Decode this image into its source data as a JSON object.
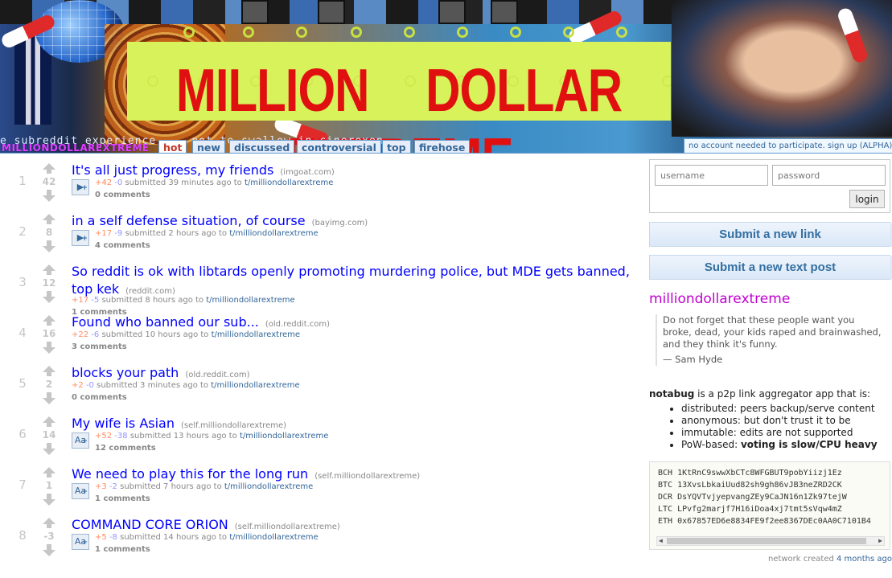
{
  "header": {
    "banner_title": "MILLION DOLLAR EXTREME",
    "ticker": "e subreddit experience ... not to swallow in cinerexen",
    "subreddit_name": "MILLIONDOLLAREXTREME",
    "tabs": [
      {
        "label": "hot",
        "selected": true
      },
      {
        "label": "new",
        "selected": false
      },
      {
        "label": "discussed",
        "selected": false
      },
      {
        "label": "controversial",
        "selected": false
      },
      {
        "label": "top",
        "selected": false
      },
      {
        "label": "firehose",
        "selected": false
      }
    ],
    "signup_text": "no account needed to participate. sign up (ALPHA)"
  },
  "posts": [
    {
      "rank": "1",
      "score": "42",
      "title": "It's all just progress, my friends",
      "domain": "(imgoat.com)",
      "type": "video",
      "ups": "+42",
      "downs": "-0",
      "time": "submitted 39 minutes ago to",
      "sub": "t/milliondollarextreme",
      "comments": "0 comments"
    },
    {
      "rank": "2",
      "score": "8",
      "title": "in a self defense situation, of course",
      "domain": "(bayimg.com)",
      "type": "video",
      "ups": "+17",
      "downs": "-9",
      "time": "submitted 2 hours ago to",
      "sub": "t/milliondollarextreme",
      "comments": "4 comments"
    },
    {
      "rank": "3",
      "score": "12",
      "title": "So reddit is ok with libtards openly promoting murdering police, but MDE gets banned, top kek",
      "domain": "(reddit.com)",
      "type": "none",
      "ups": "+17",
      "downs": "-5",
      "time": "submitted 8 hours ago to",
      "sub": "t/milliondollarextreme",
      "comments": "1 comments"
    },
    {
      "rank": "4",
      "score": "16",
      "title": "Found who banned our sub...",
      "domain": "(old.reddit.com)",
      "type": "none",
      "ups": "+22",
      "downs": "-6",
      "time": "submitted 10 hours ago to",
      "sub": "t/milliondollarextreme",
      "comments": "3 comments"
    },
    {
      "rank": "5",
      "score": "2",
      "title": "blocks your path",
      "domain": "(old.reddit.com)",
      "type": "none",
      "ups": "+2",
      "downs": "-0",
      "time": "submitted 3 minutes ago to",
      "sub": "t/milliondollarextreme",
      "comments": "0 comments"
    },
    {
      "rank": "6",
      "score": "14",
      "title": "My wife is Asian",
      "domain": "(self.milliondollarextreme)",
      "type": "text",
      "ups": "+52",
      "downs": "-38",
      "time": "submitted 13 hours ago to",
      "sub": "t/milliondollarextreme",
      "comments": "12 comments"
    },
    {
      "rank": "7",
      "score": "1",
      "title": "We need to play this for the long run",
      "domain": "(self.milliondollarextreme)",
      "type": "text",
      "ups": "+3",
      "downs": "-2",
      "time": "submitted 7 hours ago to",
      "sub": "t/milliondollarextreme",
      "comments": "1 comments"
    },
    {
      "rank": "8",
      "score": "-3",
      "title": "COMMAND CORE ORION",
      "domain": "(self.milliondollarextreme)",
      "type": "text",
      "ups": "+5",
      "downs": "-8",
      "time": "submitted 14 hours ago to",
      "sub": "t/milliondollarextreme",
      "comments": "1 comments"
    }
  ],
  "sidebar": {
    "username_placeholder": "username",
    "password_placeholder": "password",
    "login_label": "login",
    "submit_link_label": "Submit a new link",
    "submit_text_label": "Submit a new text post",
    "subreddit_title": "milliondollarextreme",
    "quote_text": "Do not forget that these people want you broke, dead, your kids raped and brainwashed, and they think it's funny.",
    "quote_attrib": "— Sam Hyde",
    "about_brand": "notabug",
    "about_intro": " is a p2p link aggregator app that is:",
    "about_items": [
      {
        "text": "distributed: peers backup/serve content",
        "bold": ""
      },
      {
        "text": "anonymous: but don't trust it to be",
        "bold": ""
      },
      {
        "text": "immutable: edits are not supported",
        "bold": ""
      },
      {
        "text": "PoW-based: ",
        "bold": "voting is slow/CPU heavy"
      }
    ],
    "wallets": [
      {
        "coin": "BCH",
        "addr": "1KtRnC9swwXbCTc8WFGBUT9pobYiizj1Ez"
      },
      {
        "coin": "BTC",
        "addr": "13XvsLbkaiUud82sh9gh86vJB3neZRD2CK"
      },
      {
        "coin": "DCR",
        "addr": "DsYQVTvjyepvangZEy9CaJN16n1Zk97tejW"
      },
      {
        "coin": "LTC",
        "addr": "LPvfg2marjf7H16iDoa4xj7tmt5sVqw4mZ"
      },
      {
        "coin": "ETH",
        "addr": "0x67857ED6e8834FE9f2ee8367DEc0AA0C7101B4"
      }
    ],
    "network_prefix": "network created ",
    "network_age": "4 months ago"
  }
}
